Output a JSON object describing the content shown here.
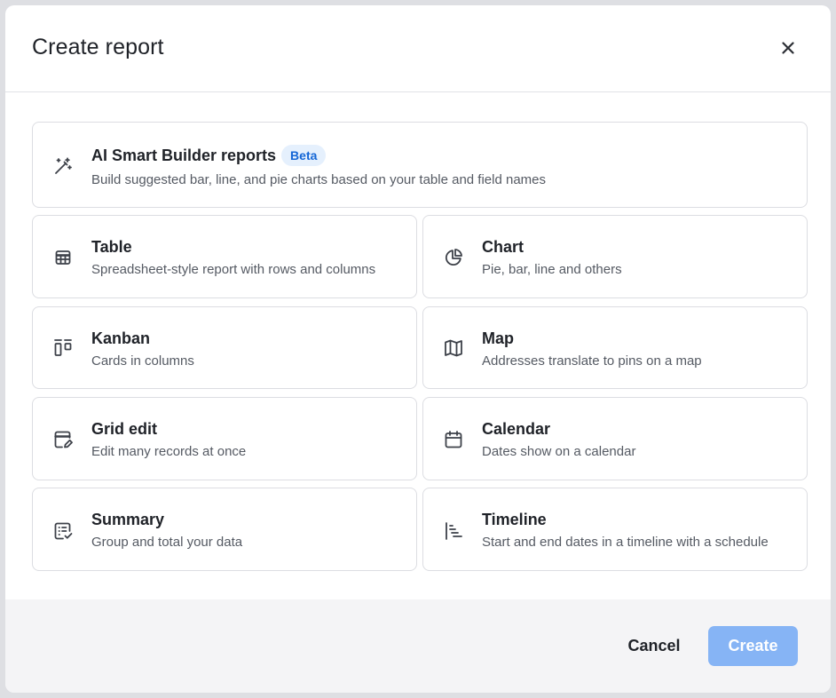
{
  "dialog": {
    "title": "Create report",
    "close_icon": "close-icon"
  },
  "options": {
    "ai": {
      "name": "AI Smart Builder reports",
      "badge": "Beta",
      "description": "Build suggested bar, line, and pie charts based on your table and field names",
      "icon": "magic-wand-icon"
    },
    "table": {
      "name": "Table",
      "description": "Spreadsheet-style report with rows and columns",
      "icon": "table-icon"
    },
    "chart": {
      "name": "Chart",
      "description": "Pie, bar, line and others",
      "icon": "pie-chart-icon"
    },
    "kanban": {
      "name": "Kanban",
      "description": "Cards in columns",
      "icon": "kanban-icon"
    },
    "map": {
      "name": "Map",
      "description": "Addresses translate to pins on a map",
      "icon": "map-icon"
    },
    "grid_edit": {
      "name": "Grid edit",
      "description": "Edit many records at once",
      "icon": "grid-edit-icon"
    },
    "calendar": {
      "name": "Calendar",
      "description": "Dates show on a calendar",
      "icon": "calendar-icon"
    },
    "summary": {
      "name": "Summary",
      "description": "Group and total your data",
      "icon": "summary-icon"
    },
    "timeline": {
      "name": "Timeline",
      "description": "Start and end dates in a timeline with a schedule",
      "icon": "timeline-icon"
    }
  },
  "footer": {
    "cancel_label": "Cancel",
    "create_label": "Create"
  },
  "colors": {
    "primary_disabled": "#86b4f5",
    "badge_bg": "#e5f0fd",
    "badge_text": "#1466d6",
    "footer_bg": "#f4f4f6"
  }
}
